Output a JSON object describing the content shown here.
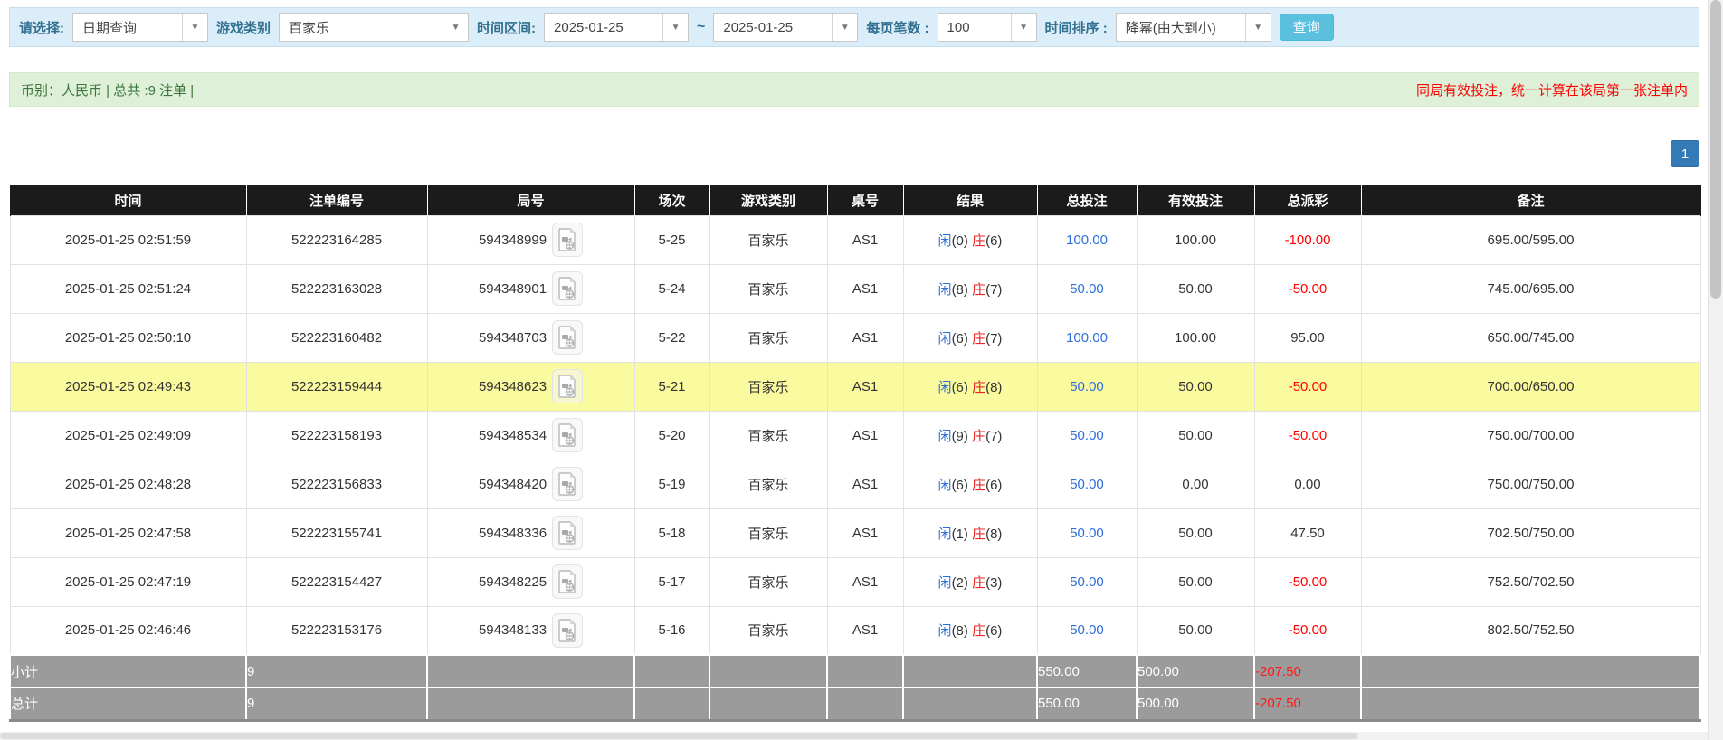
{
  "filter_bar": {
    "select_label": "请选择:",
    "query_type": "日期查询",
    "game_category_label": "游戏类别",
    "game_category": "百家乐",
    "time_range_label": "时间区间:",
    "date_from": "2025-01-25",
    "tilde": "~",
    "date_to": "2025-01-25",
    "per_page_label": "每页笔数 :",
    "per_page": "100",
    "sort_label": "时间排序 :",
    "sort_order": "降幂(由大到小)",
    "query_button": "查询",
    "dropdown_arrow": "▼"
  },
  "info_bar": {
    "left_text": "币别：人民币 | 总共 :9 注单 |",
    "right_text": "同局有效投注，统一计算在该局第一张注单内"
  },
  "pagination": {
    "page_1": "1"
  },
  "table": {
    "headers": [
      "时间",
      "注单编号",
      "局号",
      "场次",
      "游戏类别",
      "桌号",
      "结果",
      "总投注",
      "有效投注",
      "总派彩",
      "备注"
    ],
    "rows": [
      {
        "time": "2025-01-25 02:51:59",
        "bet_id": "522223164285",
        "round_id": "594348999",
        "session": "5-25",
        "game": "百家乐",
        "table": "AS1",
        "player": "闲",
        "player_pts": "(0)",
        "banker": "庄",
        "banker_pts": "(6)",
        "total_bet": "100.00",
        "valid_bet": "100.00",
        "payout": "-100.00",
        "note": "695.00/595.00",
        "highlight": false
      },
      {
        "time": "2025-01-25 02:51:24",
        "bet_id": "522223163028",
        "round_id": "594348901",
        "session": "5-24",
        "game": "百家乐",
        "table": "AS1",
        "player": "闲",
        "player_pts": "(8)",
        "banker": "庄",
        "banker_pts": "(7)",
        "total_bet": "50.00",
        "valid_bet": "50.00",
        "payout": "-50.00",
        "note": "745.00/695.00",
        "highlight": false
      },
      {
        "time": "2025-01-25 02:50:10",
        "bet_id": "522223160482",
        "round_id": "594348703",
        "session": "5-22",
        "game": "百家乐",
        "table": "AS1",
        "player": "闲",
        "player_pts": "(6)",
        "banker": "庄",
        "banker_pts": "(7)",
        "total_bet": "100.00",
        "valid_bet": "100.00",
        "payout": "95.00",
        "note": "650.00/745.00",
        "highlight": false
      },
      {
        "time": "2025-01-25 02:49:43",
        "bet_id": "522223159444",
        "round_id": "594348623",
        "session": "5-21",
        "game": "百家乐",
        "table": "AS1",
        "player": "闲",
        "player_pts": "(6)",
        "banker": "庄",
        "banker_pts": "(8)",
        "total_bet": "50.00",
        "valid_bet": "50.00",
        "payout": "-50.00",
        "note": "700.00/650.00",
        "highlight": true
      },
      {
        "time": "2025-01-25 02:49:09",
        "bet_id": "522223158193",
        "round_id": "594348534",
        "session": "5-20",
        "game": "百家乐",
        "table": "AS1",
        "player": "闲",
        "player_pts": "(9)",
        "banker": "庄",
        "banker_pts": "(7)",
        "total_bet": "50.00",
        "valid_bet": "50.00",
        "payout": "-50.00",
        "note": "750.00/700.00",
        "highlight": false
      },
      {
        "time": "2025-01-25 02:48:28",
        "bet_id": "522223156833",
        "round_id": "594348420",
        "session": "5-19",
        "game": "百家乐",
        "table": "AS1",
        "player": "闲",
        "player_pts": "(6)",
        "banker": "庄",
        "banker_pts": "(6)",
        "total_bet": "50.00",
        "valid_bet": "0.00",
        "payout": "0.00",
        "note": "750.00/750.00",
        "highlight": false
      },
      {
        "time": "2025-01-25 02:47:58",
        "bet_id": "522223155741",
        "round_id": "594348336",
        "session": "5-18",
        "game": "百家乐",
        "table": "AS1",
        "player": "闲",
        "player_pts": "(1)",
        "banker": "庄",
        "banker_pts": "(8)",
        "total_bet": "50.00",
        "valid_bet": "50.00",
        "payout": "47.50",
        "note": "702.50/750.00",
        "highlight": false
      },
      {
        "time": "2025-01-25 02:47:19",
        "bet_id": "522223154427",
        "round_id": "594348225",
        "session": "5-17",
        "game": "百家乐",
        "table": "AS1",
        "player": "闲",
        "player_pts": "(2)",
        "banker": "庄",
        "banker_pts": "(3)",
        "total_bet": "50.00",
        "valid_bet": "50.00",
        "payout": "-50.00",
        "note": "752.50/702.50",
        "highlight": false
      },
      {
        "time": "2025-01-25 02:46:46",
        "bet_id": "522223153176",
        "round_id": "594348133",
        "session": "5-16",
        "game": "百家乐",
        "table": "AS1",
        "player": "闲",
        "player_pts": "(8)",
        "banker": "庄",
        "banker_pts": "(6)",
        "total_bet": "50.00",
        "valid_bet": "50.00",
        "payout": "-50.00",
        "note": "802.50/752.50",
        "highlight": false
      }
    ],
    "subtotal": {
      "label": "小计",
      "count": "9",
      "total_bet": "550.00",
      "valid_bet": "500.00",
      "payout": "-207.50"
    },
    "total": {
      "label": "总计",
      "count": "9",
      "total_bet": "550.00",
      "valid_bet": "500.00",
      "payout": "-207.50"
    }
  },
  "icons": {
    "round_video_icon": "video-record-document"
  },
  "colors": {
    "header_bg": "#1b1b1b",
    "highlight_row": "#fafa9e",
    "summary_bg": "#9b9b9b",
    "link_blue": "#2e6fdb",
    "loss_red": "#ff0000",
    "info_green_bg": "#dff0d8",
    "filter_blue_bg": "#daedf8",
    "query_button_bg": "#5bc0de",
    "pager_blue": "#337ab7"
  }
}
